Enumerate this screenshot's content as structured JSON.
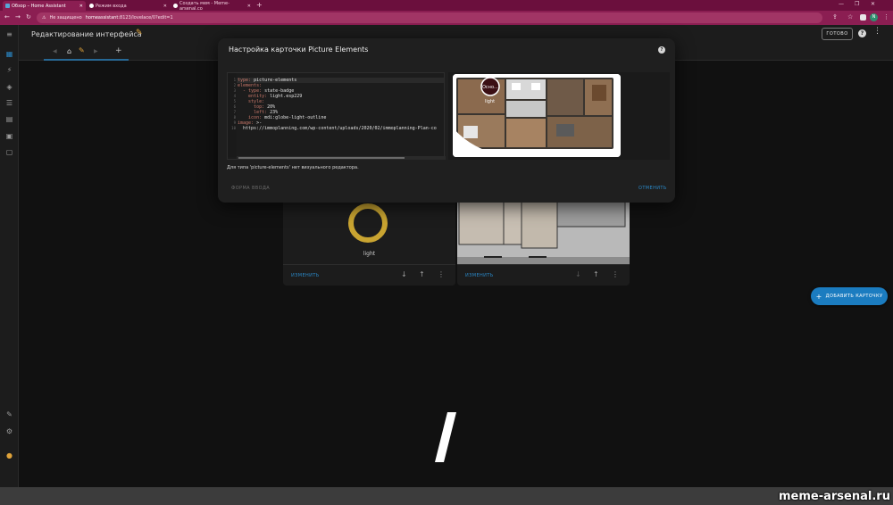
{
  "browser": {
    "tabs": [
      {
        "label": "Обзор – Home Assistant",
        "active": true
      },
      {
        "label": "Режим входа",
        "active": false
      },
      {
        "label": "Создать мем - Meme-arsenal.co",
        "active": false
      }
    ],
    "security_label": "Не защищено",
    "url_host": "homeassistant",
    "url_path": ":8123/lovelace/0?edit=1",
    "profile_initial": "N",
    "new_tab": "+"
  },
  "header": {
    "title": "Редактирование интерфейса",
    "done_label": "ГОТОВО"
  },
  "cards": {
    "entity_label": "light",
    "edit_label": "ИЗМЕНИТЬ",
    "add_card_label": "ДОБАВИТЬ КАРТОЧКУ"
  },
  "dialog": {
    "title": "Настройка карточки Picture Elements",
    "code_lines": [
      {
        "n": "1",
        "k": "type:",
        "v": " picture-elements"
      },
      {
        "n": "2",
        "k": "elements:",
        "v": ""
      },
      {
        "n": "3",
        "k": "  - type:",
        "v": " state-badge"
      },
      {
        "n": "4",
        "k": "    entity:",
        "v": " light.esp229"
      },
      {
        "n": "5",
        "k": "    style:",
        "v": ""
      },
      {
        "n": "6",
        "k": "      top:",
        "v": " 20%"
      },
      {
        "n": "7",
        "k": "      left:",
        "v": " 23%"
      },
      {
        "n": "8",
        "k": "    icon:",
        "v": " mdi:globe-light-outline"
      },
      {
        "n": "9",
        "k": "image:",
        "v": " >-"
      },
      {
        "n": "10",
        "k": "",
        "v": "  https://immoplanning.com/wp-content/uploads/2020/02/immoplanning-Plan-co"
      }
    ],
    "preview_badge": "Осно...",
    "preview_badge_label": "light",
    "message": "Для типа 'picture-elements' нет визуального редактора.",
    "code_editor_button": "ФОРМА ВВОДА",
    "cancel_button": "ОТМЕНИТЬ"
  },
  "watermark": "meme-arsenal.ru",
  "colors": {
    "accent": "#2a88c7",
    "browser_frame": "#8b1e52",
    "light_ring": "#c9a431"
  }
}
